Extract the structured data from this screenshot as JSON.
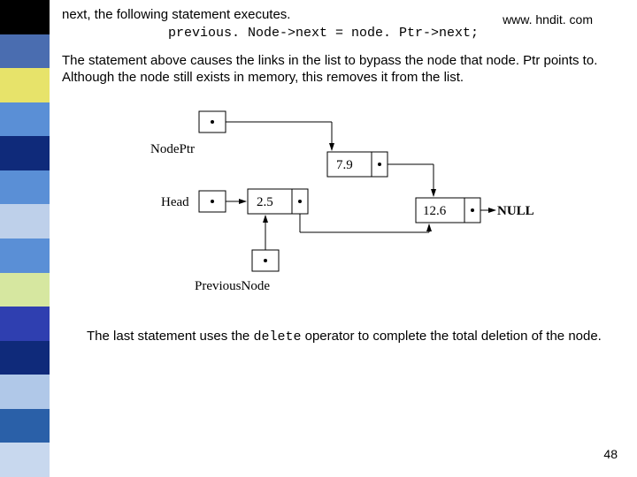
{
  "sidebar_colors": [
    "#000000",
    "#4a6db0",
    "#e7e36a",
    "#5a8fd6",
    "#0f2a7a",
    "#5a8fd6",
    "#bed0ea",
    "#5a8fd6",
    "#d6e7a0",
    "#2f3fb0",
    "#0f2a7a",
    "#b0c8e8",
    "#2a60a8",
    "#c8d8ee"
  ],
  "top": {
    "line": "next, the following statement executes."
  },
  "watermark": "www. hndit. com",
  "code": "previous. Node->next = node. Ptr->next;",
  "para1": "The statement above causes the links in the list to bypass the node that node. Ptr points to. Although the node still exists in memory, this removes it from the list.",
  "para2_a": "The last statement uses the ",
  "para2_code": "delete",
  "para2_b": " operator to complete the total deletion of the node.",
  "pagenum": "48",
  "diagram": {
    "nodeptr_label": "NodePtr",
    "head_label": "Head",
    "prevnode_label": "PreviousNode",
    "val1": "2.5",
    "val2": "7.9",
    "val3": "12.6",
    "null_label": "NULL"
  }
}
